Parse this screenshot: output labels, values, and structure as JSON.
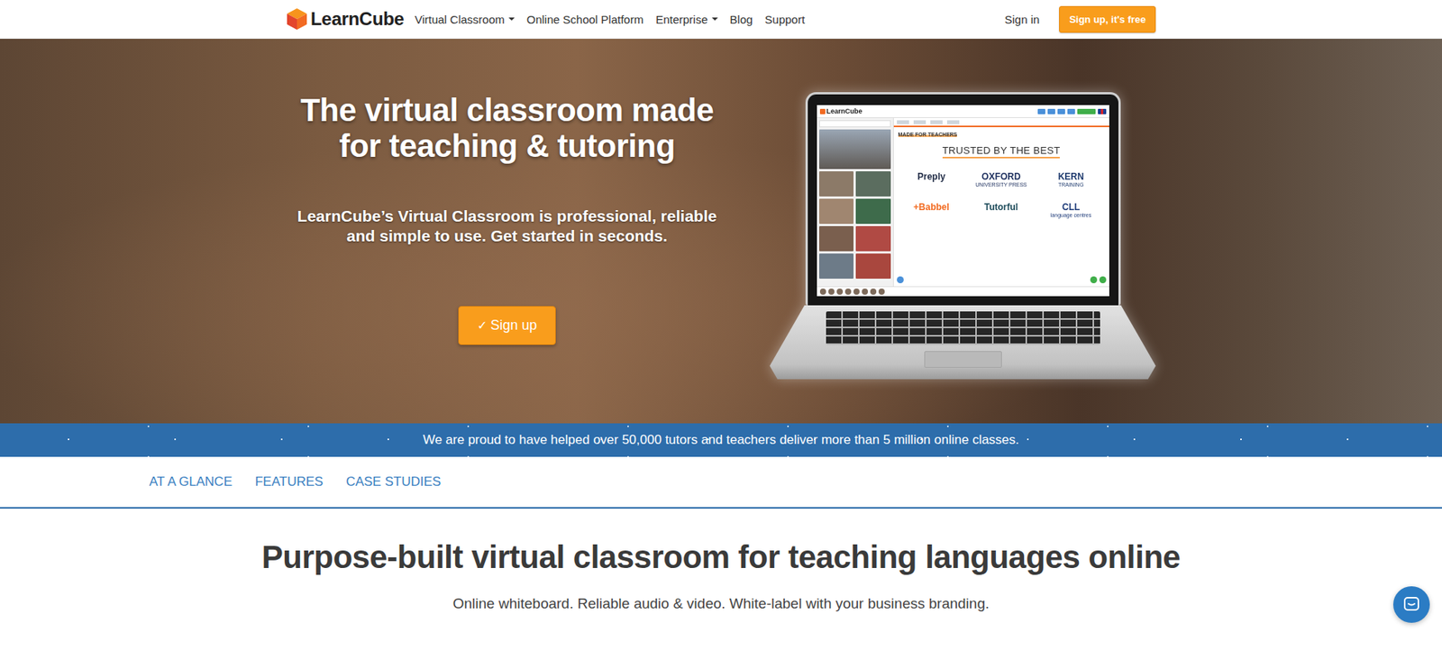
{
  "nav": {
    "logo": "LearnCube",
    "items": [
      {
        "label": "Virtual Classroom",
        "dropdown": true
      },
      {
        "label": "Online School Platform",
        "dropdown": false
      },
      {
        "label": "Enterprise",
        "dropdown": true
      },
      {
        "label": "Blog",
        "dropdown": false
      },
      {
        "label": "Support",
        "dropdown": false
      }
    ],
    "sign_in": "Sign in",
    "cta": "Sign up, it's free"
  },
  "hero": {
    "title": "The virtual classroom made for teaching & tutoring",
    "subtitle": "LearnCube’s Virtual Classroom is professional, reliable and simple to use. Get started in seconds.",
    "button": {
      "icon": "✓",
      "label": "Sign up"
    }
  },
  "laptop_screen": {
    "app_logo": "LearnCube",
    "tagline": "MADE FOR TEACHERS",
    "heading": "TRUSTED BY THE BEST",
    "logos": [
      {
        "name": "Preply",
        "sub": "",
        "color": "#1f2a44"
      },
      {
        "name": "OXFORD",
        "sub": "UNIVERSITY PRESS",
        "color": "#1d2f5e"
      },
      {
        "name": "KERN",
        "sub": "TRAINING",
        "color": "#1e3a6e"
      },
      {
        "name": "+Babbel",
        "sub": "",
        "color": "#f26b21"
      },
      {
        "name": "Tutorful",
        "sub": "",
        "color": "#1d4b5a"
      },
      {
        "name": "CLL",
        "sub": "language centres",
        "color": "#1d3a78"
      }
    ]
  },
  "banner": "We are proud to have helped over 50,000 tutors and teachers deliver more than 5 million online classes.",
  "section_tabs": [
    {
      "label": "AT A GLANCE",
      "selected": false
    },
    {
      "label": "FEATURES",
      "selected": false
    },
    {
      "label": "CASE STUDIES",
      "selected": false
    }
  ],
  "section": {
    "heading": "Purpose-built virtual classroom for teaching languages online",
    "subheading": "Online whiteboard. Reliable audio & video. White-label with your business branding."
  }
}
